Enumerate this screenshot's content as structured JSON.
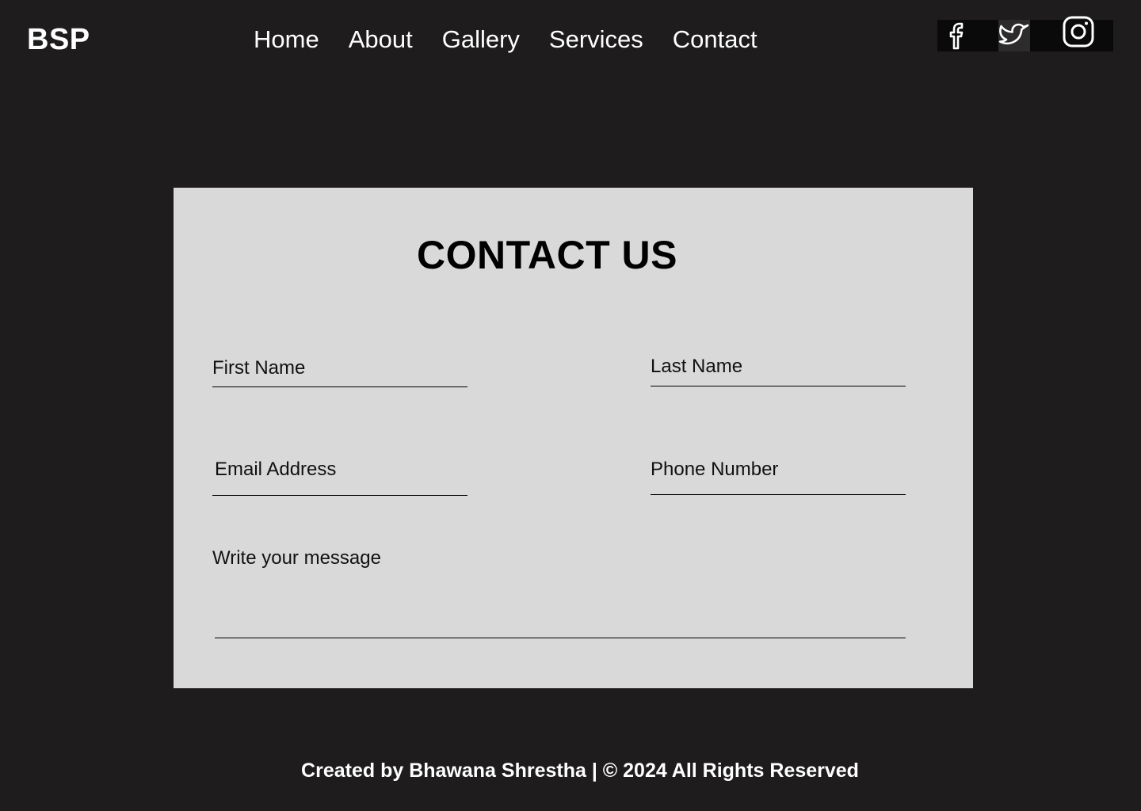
{
  "header": {
    "logo": "BSP",
    "nav": [
      "Home",
      "About",
      "Gallery",
      "Services",
      "Contact"
    ],
    "social": [
      "facebook-icon",
      "twitter-icon",
      "instagram-icon"
    ]
  },
  "contact": {
    "title": "CONTACT US",
    "first_name_placeholder": "First Name",
    "last_name_placeholder": "Last Name",
    "email_placeholder": "Email Address",
    "phone_placeholder": "Phone Number",
    "message_placeholder": "Write your message"
  },
  "footer": {
    "text": "Created by Bhawana Shrestha | © 2024 All Rights Reserved"
  },
  "colors": {
    "background": "#1e1c1d",
    "card": "#d9d9d9",
    "text_light": "#ffffff",
    "text_dark": "#000000"
  }
}
